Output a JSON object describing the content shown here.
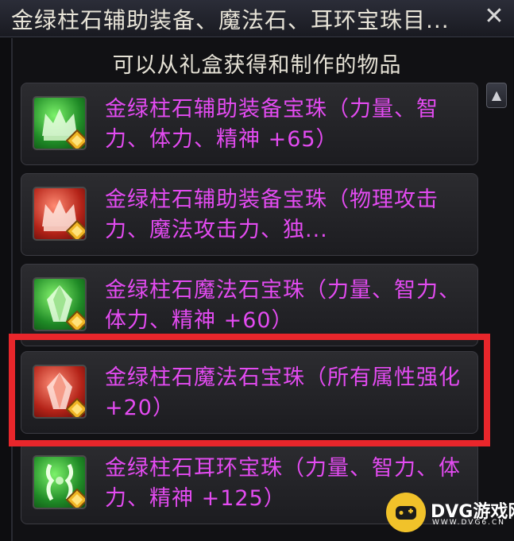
{
  "window": {
    "title": "金绿柱石辅助装备、魔法石、耳环宝珠目...",
    "close_label": "✕"
  },
  "subtitle": "可以从礼盒获得和制作的物品",
  "colors": {
    "item_text": "#e34bf1",
    "highlight": "#e8262b",
    "green_icon": "#2fb238",
    "red_icon": "#c62d24"
  },
  "items": [
    {
      "label": "金绿柱石辅助装备宝珠（力量、智力、体力、精神 +65）",
      "icon": "green-crown-icon"
    },
    {
      "label": "金绿柱石辅助装备宝珠（物理攻击力、魔法攻击力、独...",
      "icon": "red-crown-icon"
    },
    {
      "label": "金绿柱石魔法石宝珠（力量、智力、体力、精神 +60）",
      "icon": "green-crystal-icon"
    },
    {
      "label": "金绿柱石魔法石宝珠（所有属性强化 +20）",
      "icon": "red-crystal-icon"
    },
    {
      "label": "金绿柱石耳环宝珠（力量、智力、体力、精神 +125）",
      "icon": "green-earring-icon"
    }
  ],
  "watermark": {
    "name": "DVG游戏网",
    "site": "WWW.DVG6.CN"
  }
}
